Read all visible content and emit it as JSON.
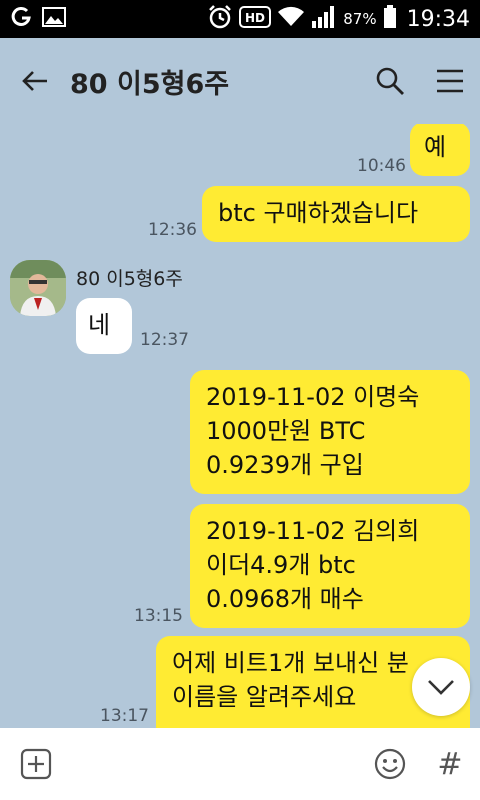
{
  "status_bar": {
    "battery_percent": "87%",
    "time": "19:34",
    "icons": [
      "carrier-logo-icon",
      "gallery-icon",
      "alarm-icon",
      "hd-icon",
      "wifi-icon",
      "signal-icon",
      "battery-icon"
    ]
  },
  "header": {
    "title": "80 이5형6주",
    "icons": [
      "back-arrow-icon",
      "search-icon",
      "menu-icon"
    ]
  },
  "messages": [
    {
      "side": "right",
      "text": "예",
      "time": "10:46"
    },
    {
      "side": "right",
      "text": "btc 구매하겠습니다",
      "time": "12:36"
    },
    {
      "side": "left",
      "sender": "80 이5형6주",
      "text": "네",
      "time": "12:37"
    },
    {
      "side": "right",
      "text": "2019-11-02 이명숙\n1000만원 BTC\n0.9239개 구입",
      "time": ""
    },
    {
      "side": "right",
      "text": "2019-11-02 김의희\n이더4.9개 btc\n0.0968개 매수",
      "time": "13:15"
    },
    {
      "side": "right",
      "text": "어제 비트1개 보내신 분\n이름을 알려주세요",
      "time": "13:17"
    }
  ],
  "input": {
    "placeholder": "",
    "hash_label": "#"
  },
  "colors": {
    "chat_background": "#b2c7d9",
    "my_bubble": "#ffeb33",
    "other_bubble": "#ffffff"
  }
}
